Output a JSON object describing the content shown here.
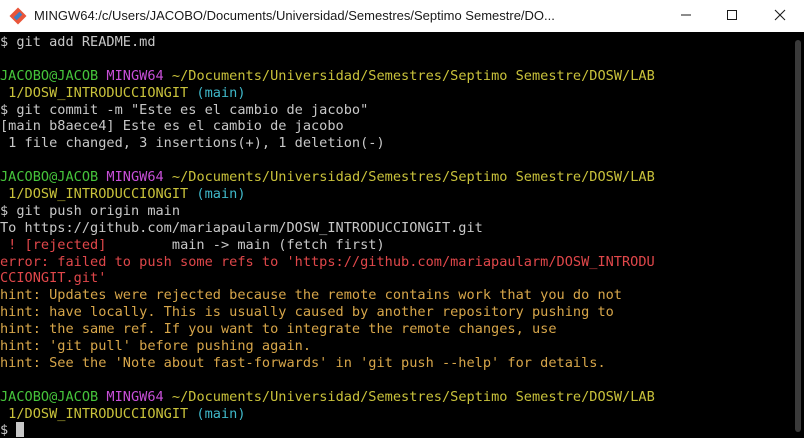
{
  "window": {
    "title": "MINGW64:/c/Users/JACOBO/Documents/Universidad/Semestres/Septimo Semestre/DO...",
    "colors": {
      "titlebar": "#ffffff",
      "background": "#000000"
    },
    "icons": {
      "app": "git-bash-icon",
      "minimize": "minimize-icon",
      "maximize": "maximize-icon",
      "close": "close-icon"
    }
  },
  "terminal": {
    "colors": {
      "text": "#c8c8c8",
      "user": "#46c43b",
      "env": "#c84fd8",
      "path": "#c9c23b",
      "branch": "#3fb8c9",
      "error": "#e0474a",
      "hint": "#d7a64a"
    },
    "lines": [
      [
        {
          "c": "",
          "t": "$ git add README.md"
        }
      ],
      [
        {
          "c": "",
          "t": ""
        }
      ],
      [
        {
          "c": "green",
          "t": "JACOBO@JACOB "
        },
        {
          "c": "magenta",
          "t": "MINGW64 "
        },
        {
          "c": "yellow",
          "t": "~/Documents/Universidad/Semestres/Septimo Semestre/DOSW/LAB"
        }
      ],
      [
        {
          "c": "yellow",
          "t": " 1/DOSW_INTRODUCCIONGIT "
        },
        {
          "c": "cyan",
          "t": "(main)"
        }
      ],
      [
        {
          "c": "",
          "t": "$ git commit -m \"Este es el cambio de jacobo\""
        }
      ],
      [
        {
          "c": "",
          "t": "[main b8aece4] Este es el cambio de jacobo"
        }
      ],
      [
        {
          "c": "",
          "t": " 1 file changed, 3 insertions(+), 1 deletion(-)"
        }
      ],
      [
        {
          "c": "",
          "t": ""
        }
      ],
      [
        {
          "c": "green",
          "t": "JACOBO@JACOB "
        },
        {
          "c": "magenta",
          "t": "MINGW64 "
        },
        {
          "c": "yellow",
          "t": "~/Documents/Universidad/Semestres/Septimo Semestre/DOSW/LAB"
        }
      ],
      [
        {
          "c": "yellow",
          "t": " 1/DOSW_INTRODUCCIONGIT "
        },
        {
          "c": "cyan",
          "t": "(main)"
        }
      ],
      [
        {
          "c": "",
          "t": "$ git push origin main"
        }
      ],
      [
        {
          "c": "",
          "t": "To https://github.com/mariapaularm/DOSW_INTRODUCCIONGIT.git"
        }
      ],
      [
        {
          "c": "red",
          "t": " ! [rejected]"
        },
        {
          "c": "",
          "t": "        main -> main (fetch first)"
        }
      ],
      [
        {
          "c": "red",
          "t": "error: failed to push some refs to 'https://github.com/mariapaularm/DOSW_INTRODU"
        }
      ],
      [
        {
          "c": "red",
          "t": "CCIONGIT.git'"
        }
      ],
      [
        {
          "c": "hintc",
          "t": "hint: Updates were rejected because the remote contains work that you do not"
        }
      ],
      [
        {
          "c": "hintc",
          "t": "hint: have locally. This is usually caused by another repository pushing to"
        }
      ],
      [
        {
          "c": "hintc",
          "t": "hint: the same ref. If you want to integrate the remote changes, use"
        }
      ],
      [
        {
          "c": "hintc",
          "t": "hint: 'git pull' before pushing again."
        }
      ],
      [
        {
          "c": "hintc",
          "t": "hint: See the 'Note about fast-forwards' in 'git push --help' for details."
        }
      ],
      [
        {
          "c": "",
          "t": ""
        }
      ],
      [
        {
          "c": "green",
          "t": "JACOBO@JACOB "
        },
        {
          "c": "magenta",
          "t": "MINGW64 "
        },
        {
          "c": "yellow",
          "t": "~/Documents/Universidad/Semestres/Septimo Semestre/DOSW/LAB"
        }
      ],
      [
        {
          "c": "yellow",
          "t": " 1/DOSW_INTRODUCCIONGIT "
        },
        {
          "c": "cyan",
          "t": "(main)"
        }
      ],
      [
        {
          "c": "",
          "t": "$ "
        }
      ]
    ]
  }
}
